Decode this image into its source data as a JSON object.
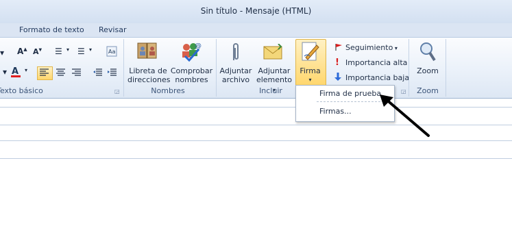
{
  "window": {
    "title": "Sin título  -  Mensaje (HTML)"
  },
  "tabs": [
    "Formato de texto",
    "Revisar"
  ],
  "groups": {
    "texto_basico": "Texto básico",
    "nombres": "Nombres",
    "incluir": "Incluir",
    "zoom": "Zoom"
  },
  "buttons": {
    "libreta_line1": "Libreta de",
    "libreta_line2": "direcciones",
    "comprobar_line1": "Comprobar",
    "comprobar_line2": "nombres",
    "adjuntar_archivo_line1": "Adjuntar",
    "adjuntar_archivo_line2": "archivo",
    "adjuntar_elemento_line1": "Adjuntar",
    "adjuntar_elemento_line2": "elemento",
    "firma": "Firma",
    "seguimiento": "Seguimiento",
    "importancia_alta": "Importancia alta",
    "importancia_baja": "Importancia baja",
    "zoom": "Zoom"
  },
  "firma_menu": {
    "items": [
      "Firma de prueba",
      "Firmas..."
    ]
  },
  "colors": {
    "highlight": "#ffd66b",
    "font_color": "#e02020",
    "flag": "#d81e1e"
  }
}
